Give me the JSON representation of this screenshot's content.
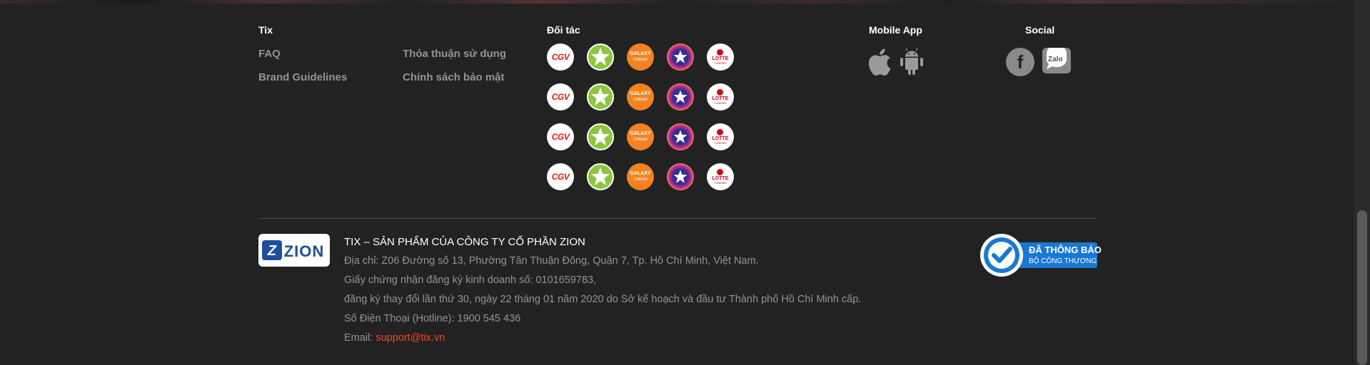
{
  "colors": {
    "background": "#222222",
    "heading": "#ffffff",
    "link": "#949494",
    "accent": "#fb4226",
    "badge_blue": "#1a77d2"
  },
  "columns": {
    "tix": {
      "title": "Tix",
      "links": [
        "FAQ",
        "Brand Guidelines",
        "Thỏa thuận sử dụng",
        "Chính sách bảo mật"
      ]
    },
    "partners": {
      "title": "Đối tác",
      "rows": [
        [
          "CGV",
          "BHD",
          "GALAXY",
          "Cinestar",
          "LOTTE"
        ],
        [
          "CGV",
          "BHD",
          "GALAXY",
          "Cinestar",
          "LOTTE"
        ],
        [
          "CGV",
          "BHD",
          "GALAXY",
          "Cinestar",
          "LOTTE"
        ],
        [
          "CGV",
          "BHD",
          "GALAXY",
          "Cinestar",
          "LOTTE"
        ]
      ],
      "logo_text": {
        "cgv": "CGV",
        "bhd": "BHD",
        "galaxy_top": "GALAXY",
        "galaxy_bottom": "CINEMA",
        "lotte_top": "LOTTE",
        "lotte_bottom": "CINEMA"
      }
    },
    "mobile": {
      "title": "Mobile App",
      "icons": [
        "apple-icon",
        "android-icon"
      ]
    },
    "social": {
      "title": "Social",
      "icons": [
        "facebook-icon",
        "zalo-icon"
      ],
      "facebook_glyph": "f",
      "zalo_label": "Zalo"
    }
  },
  "company": {
    "logo_text": "ZION",
    "title": "TIX – SẢN PHẨM CỦA CÔNG TY CỔ PHẦN ZION",
    "address": "Địa chỉ: Z06 Đường số 13, Phường Tân Thuận Đông, Quận 7, Tp. Hồ Chí Minh, Việt Nam.",
    "license": "Giấy chứng nhận đăng ký kinh doanh số: 0101659783,",
    "registration": "đăng ký thay đổi lần thứ 30, ngày 22 tháng 01 năm 2020 do Sở kế hoạch và đầu tư Thành phố Hồ Chí Minh cấp.",
    "phone": "Số Điện Thoại (Hotline): 1900 545 436",
    "email_label": "Email: ",
    "email": "support@tix.vn"
  },
  "badge": {
    "line1": "ĐÃ THÔNG BÁO",
    "line2": "BỘ CÔNG THƯƠNG"
  }
}
